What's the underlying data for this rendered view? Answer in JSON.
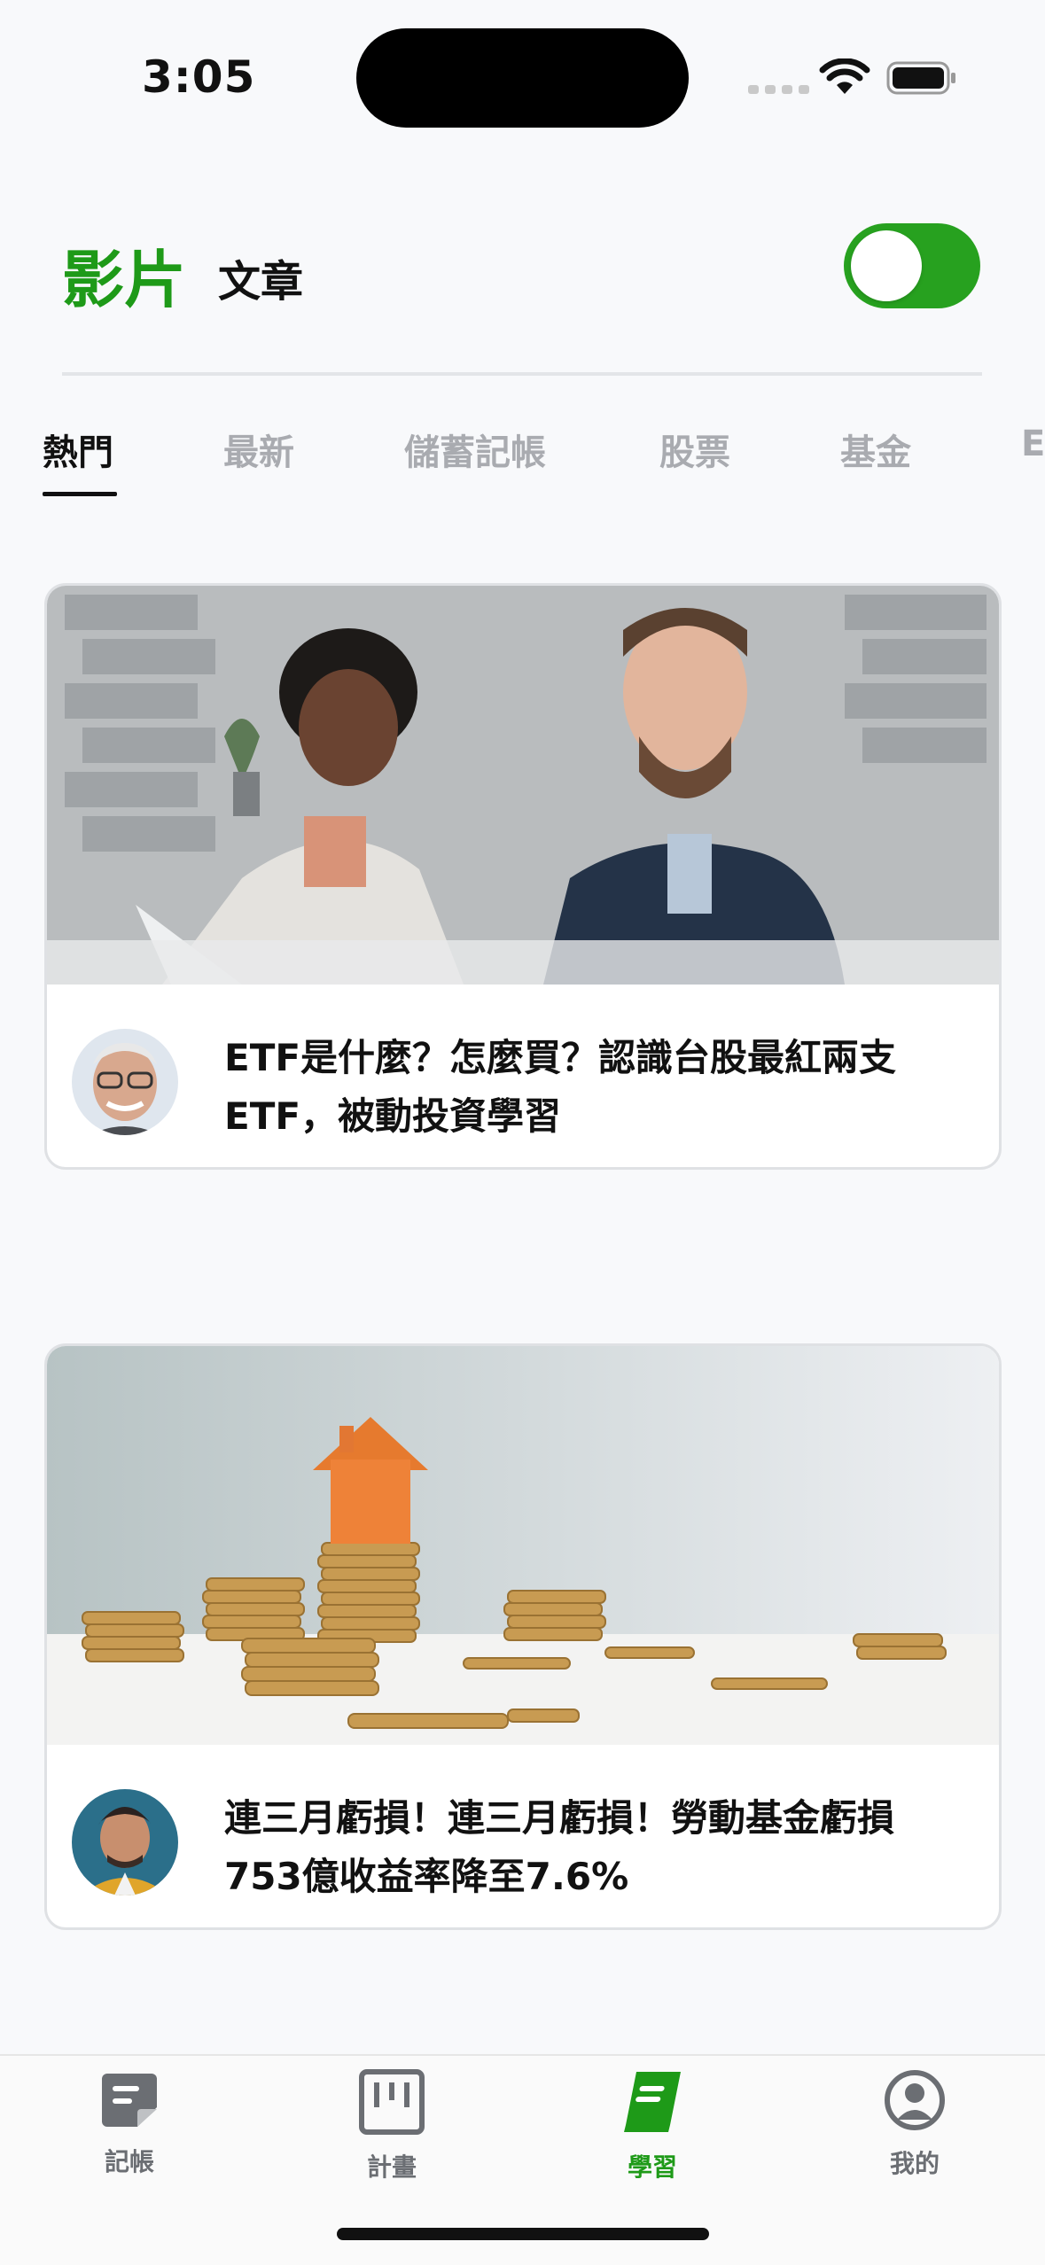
{
  "status_bar": {
    "time": "3:05"
  },
  "header": {
    "video_tab": "影片",
    "article_tab": "文章",
    "toggle_on": true
  },
  "categories": [
    "熱門",
    "最新",
    "儲蓄記帳",
    "股票",
    "基金",
    "E"
  ],
  "active_category": "熱門",
  "cards": [
    {
      "title_line1": "ETF是什麼？怎麼買？認識台股最紅兩支",
      "title_line2": "ETF，被動投資學習",
      "avatar": "elderly-man-glasses-avatar",
      "image": "business-meeting-laptop-photo"
    },
    {
      "title_line1": "連三月虧損！連三月虧損！勞動基金虧損",
      "title_line2": "753億收益率降至7.6%",
      "avatar": "man-yellow-jacket-avatar",
      "image": "house-on-coin-stacks-photo"
    }
  ],
  "tabbar": {
    "items": [
      {
        "label": "記帳",
        "icon": "note-icon"
      },
      {
        "label": "計畫",
        "icon": "board-icon"
      },
      {
        "label": "學習",
        "icon": "book-icon"
      },
      {
        "label": "我的",
        "icon": "profile-icon"
      }
    ],
    "active": "學習"
  },
  "colors": {
    "accent": "#1e9a18",
    "inactive": "#a9abb0",
    "background": "#f8f9fb"
  }
}
